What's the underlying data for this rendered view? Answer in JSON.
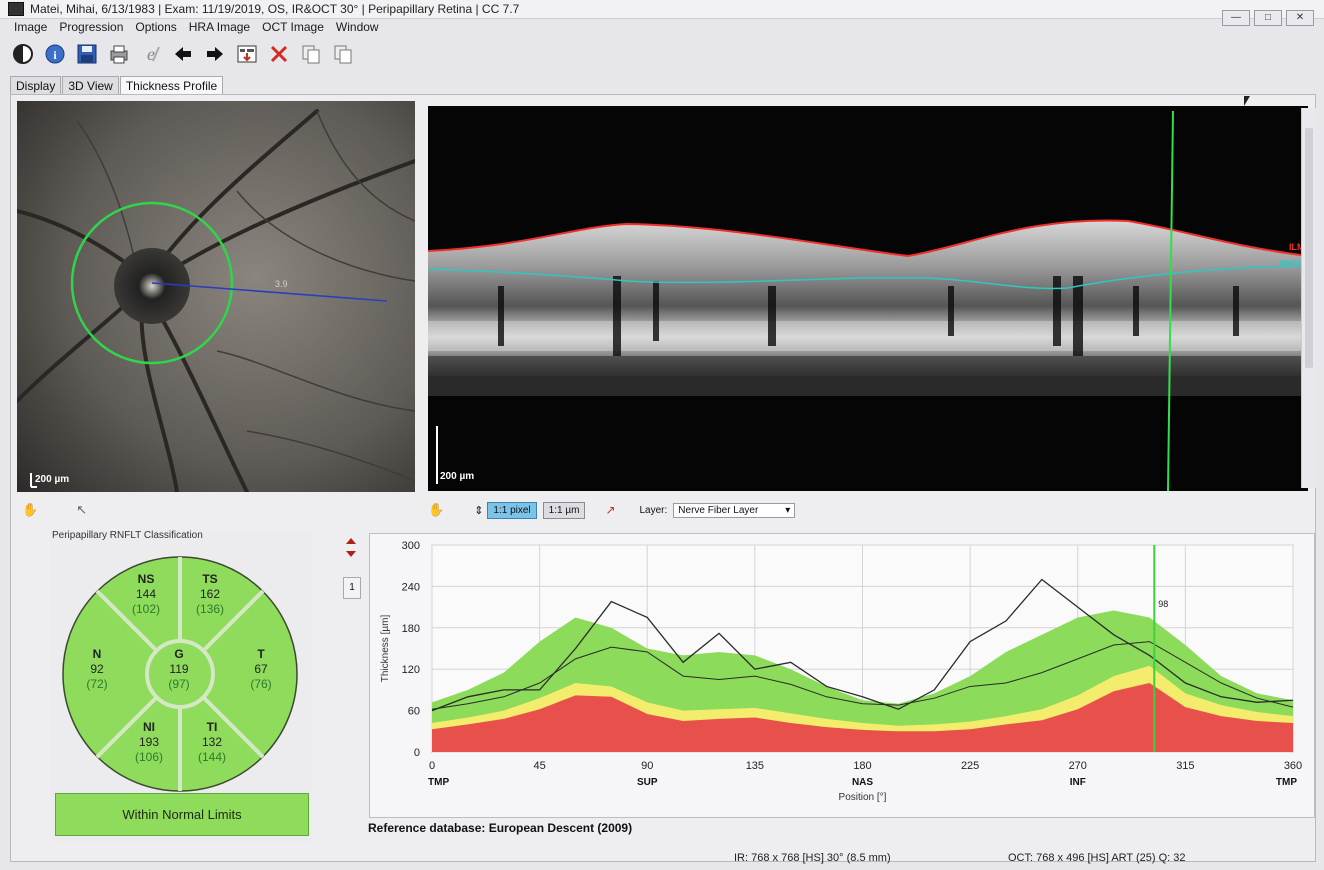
{
  "window": {
    "title": "Matei, Mihai, 6/13/1983  |  Exam: 11/19/2019, OS, IR&OCT 30°  |  Peripapillary Retina  |  CC 7.7"
  },
  "menu": [
    "Image",
    "Progression",
    "Options",
    "HRA Image",
    "OCT Image",
    "Window"
  ],
  "toolbar_icons": [
    "contrast-icon",
    "info-icon",
    "save-icon",
    "print-icon",
    "edit-icon",
    "back-arrow-icon",
    "forward-arrow-icon",
    "report-icon",
    "close-icon",
    "copy-icon",
    "copy-all-icon"
  ],
  "tabs": [
    {
      "label": "Display",
      "active": false
    },
    {
      "label": "3D View",
      "active": false
    },
    {
      "label": "Thickness Profile",
      "active": true
    }
  ],
  "fundus": {
    "scale": "200 µm",
    "measure": "3.9"
  },
  "oct": {
    "scale": "200 µm",
    "layer_ilm": "ILM",
    "layer_rnfl": "RNFL"
  },
  "controls": {
    "pixel_1to1": "1:1 pixel",
    "um_1to1": "1:1 µm",
    "layer_label": "Layer:",
    "layer_value": "Nerve Fiber Layer"
  },
  "classification": {
    "caption": "Peripapillary RNFLT Classification",
    "sectors": [
      {
        "id": "NS",
        "label": "NS",
        "value": "144",
        "ref": "(102)"
      },
      {
        "id": "TS",
        "label": "TS",
        "value": "162",
        "ref": "(136)"
      },
      {
        "id": "N",
        "label": "N",
        "value": "92",
        "ref": "(72)"
      },
      {
        "id": "G",
        "label": "G",
        "value": "119",
        "ref": "(97)"
      },
      {
        "id": "T",
        "label": "T",
        "value": "67",
        "ref": "(76)"
      },
      {
        "id": "NI",
        "label": "NI",
        "value": "193",
        "ref": "(106)"
      },
      {
        "id": "TI",
        "label": "TI",
        "value": "132",
        "ref": "(144)"
      }
    ],
    "result": "Within Normal Limits",
    "color_normal": "#8fdb5c"
  },
  "page_number": "1",
  "chart_data": {
    "type": "area",
    "ylabel": "Thickness [µm]",
    "xlabel": "Position [°]",
    "ylim": [
      0,
      300
    ],
    "xlim": [
      0,
      360
    ],
    "y_ticks": [
      0,
      60,
      120,
      180,
      240,
      300
    ],
    "x_ticks": [
      0,
      45,
      90,
      135,
      180,
      225,
      270,
      315,
      360
    ],
    "x_regions": [
      {
        "x": 0,
        "label": "TMP"
      },
      {
        "x": 90,
        "label": "SUP"
      },
      {
        "x": 180,
        "label": "NAS"
      },
      {
        "x": 270,
        "label": "INF"
      },
      {
        "x": 360,
        "label": "TMP"
      }
    ],
    "cursor": {
      "x": 302,
      "label": "98"
    },
    "grid": true,
    "x": [
      0,
      15,
      30,
      45,
      60,
      75,
      90,
      105,
      120,
      135,
      150,
      165,
      180,
      195,
      210,
      225,
      240,
      255,
      270,
      285,
      300,
      315,
      330,
      345,
      360
    ],
    "bands": {
      "red_upper": [
        33,
        40,
        48,
        62,
        82,
        80,
        55,
        45,
        48,
        50,
        42,
        36,
        32,
        30,
        30,
        33,
        40,
        46,
        62,
        88,
        100,
        65,
        52,
        45,
        42
      ],
      "yellow_upper": [
        42,
        50,
        60,
        78,
        100,
        95,
        72,
        60,
        62,
        64,
        56,
        48,
        42,
        38,
        40,
        44,
        52,
        62,
        82,
        110,
        125,
        85,
        68,
        58,
        52
      ],
      "green_upper": [
        72,
        90,
        115,
        160,
        195,
        180,
        150,
        140,
        145,
        140,
        120,
        95,
        75,
        70,
        85,
        110,
        145,
        170,
        195,
        205,
        195,
        155,
        110,
        85,
        75
      ]
    },
    "series": [
      {
        "values": [
          62,
          70,
          80,
          100,
          135,
          152,
          145,
          110,
          105,
          110,
          98,
          80,
          70,
          68,
          78,
          95,
          100,
          115,
          135,
          155,
          160,
          130,
          100,
          78,
          65
        ]
      },
      {
        "values": [
          60,
          80,
          90,
          90,
          150,
          218,
          195,
          130,
          172,
          120,
          130,
          95,
          80,
          62,
          90,
          160,
          190,
          250,
          210,
          170,
          140,
          100,
          80,
          72,
          75
        ]
      }
    ],
    "colors": {
      "red": "#e8514b",
      "yellow": "#f3ec6c",
      "green": "#8cdb5a",
      "series": "#2a2a2a",
      "cursor": "#3ed13e"
    }
  },
  "reference_db": "Reference database: European Descent (2009)",
  "status": {
    "ir": "IR: 768 x 768 [HS] 30° (8.5 mm)",
    "oct": "OCT: 768 x 496 [HS] ART (25) Q: 32"
  }
}
